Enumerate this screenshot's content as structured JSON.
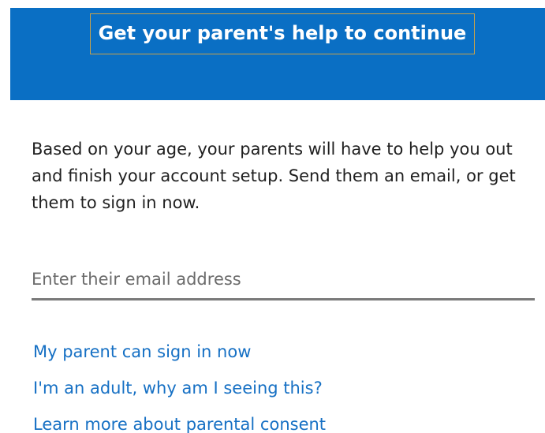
{
  "header": {
    "title": "Get your parent's help to continue"
  },
  "main": {
    "description": "Based on your age, your parents will have to help you out and finish your account setup. Send them an email, or get them to sign in now.",
    "email_field": {
      "value": "",
      "placeholder": "Enter their email address"
    },
    "links": [
      {
        "label": "My parent can sign in now"
      },
      {
        "label": "I'm an adult, why am I seeing this?"
      },
      {
        "label": "Learn more about parental consent"
      }
    ]
  },
  "colors": {
    "header_bg": "#0a6fc4",
    "link": "#1670c4",
    "focus_outline": "#c9a24a"
  }
}
